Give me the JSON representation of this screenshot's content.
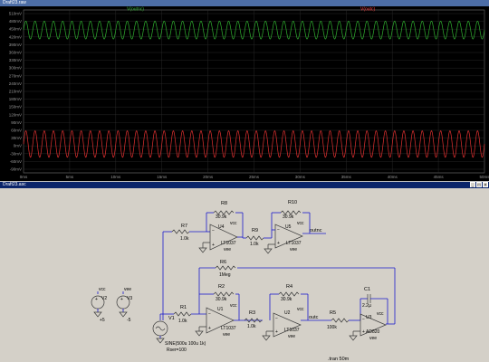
{
  "plot_window": {
    "title": "Draft23.raw",
    "traces": [
      {
        "name": "V(outnc)",
        "color": "#3fbf3f"
      },
      {
        "name": "V(outc)",
        "color": "#ff4040"
      }
    ],
    "y_ticks": [
      "510mV",
      "480mV",
      "450mV",
      "420mV",
      "390mV",
      "360mV",
      "330mV",
      "300mV",
      "270mV",
      "240mV",
      "210mV",
      "180mV",
      "150mV",
      "120mV",
      "90mV",
      "60mV",
      "30mV",
      "0mV",
      "-30mV",
      "-60mV",
      "-90mV"
    ],
    "x_ticks": [
      "0ms",
      "5ms",
      "10ms",
      "15ms",
      "20ms",
      "25ms",
      "30ms",
      "35ms",
      "40ms",
      "45ms",
      "50ms"
    ]
  },
  "schematic_window": {
    "title": "Draft23.asc",
    "components": {
      "R8": {
        "ref": "R8",
        "value": "30.9k"
      },
      "R10": {
        "ref": "R10",
        "value": "30.9k"
      },
      "R7": {
        "ref": "R7",
        "value": "1.0k"
      },
      "R9": {
        "ref": "R9",
        "value": "1.0k"
      },
      "U4": {
        "ref": "U4",
        "model": "LT1037",
        "vcc": "vcc",
        "vee": "vee"
      },
      "U5": {
        "ref": "U5",
        "model": "LT1037",
        "vcc": "vcc",
        "vee": "vee"
      },
      "R6": {
        "ref": "R6",
        "value": "1Meg"
      },
      "R2": {
        "ref": "R2",
        "value": "30.9k"
      },
      "R4": {
        "ref": "R4",
        "value": "30.9k"
      },
      "C1": {
        "ref": "C1",
        "value": "2.2µ"
      },
      "R1": {
        "ref": "R1",
        "value": "1.0k"
      },
      "R3": {
        "ref": "R3",
        "value": "1.0k"
      },
      "R5": {
        "ref": "R5",
        "value": "100k"
      },
      "U1": {
        "ref": "U1",
        "model": "LT1037",
        "vcc": "vcc",
        "vee": "vee"
      },
      "U2": {
        "ref": "U2",
        "model": "LT1037",
        "vcc": "vcc",
        "vee": "vee"
      },
      "U3": {
        "ref": "U3",
        "model": "AD820",
        "vcc": "vcc",
        "vee": "vee"
      },
      "V1": {
        "ref": "V1",
        "value": "SINE(500u 100u 1k)",
        "rser": "Rser=100"
      },
      "V2": {
        "ref": "V2",
        "net": "vcc",
        "value": "+5"
      },
      "V3": {
        "ref": "V3",
        "net": "vee",
        "value": "-5"
      }
    },
    "nets": {
      "outnc": "outnc",
      "outc": "outc"
    },
    "directive": ".tran 50m"
  }
}
